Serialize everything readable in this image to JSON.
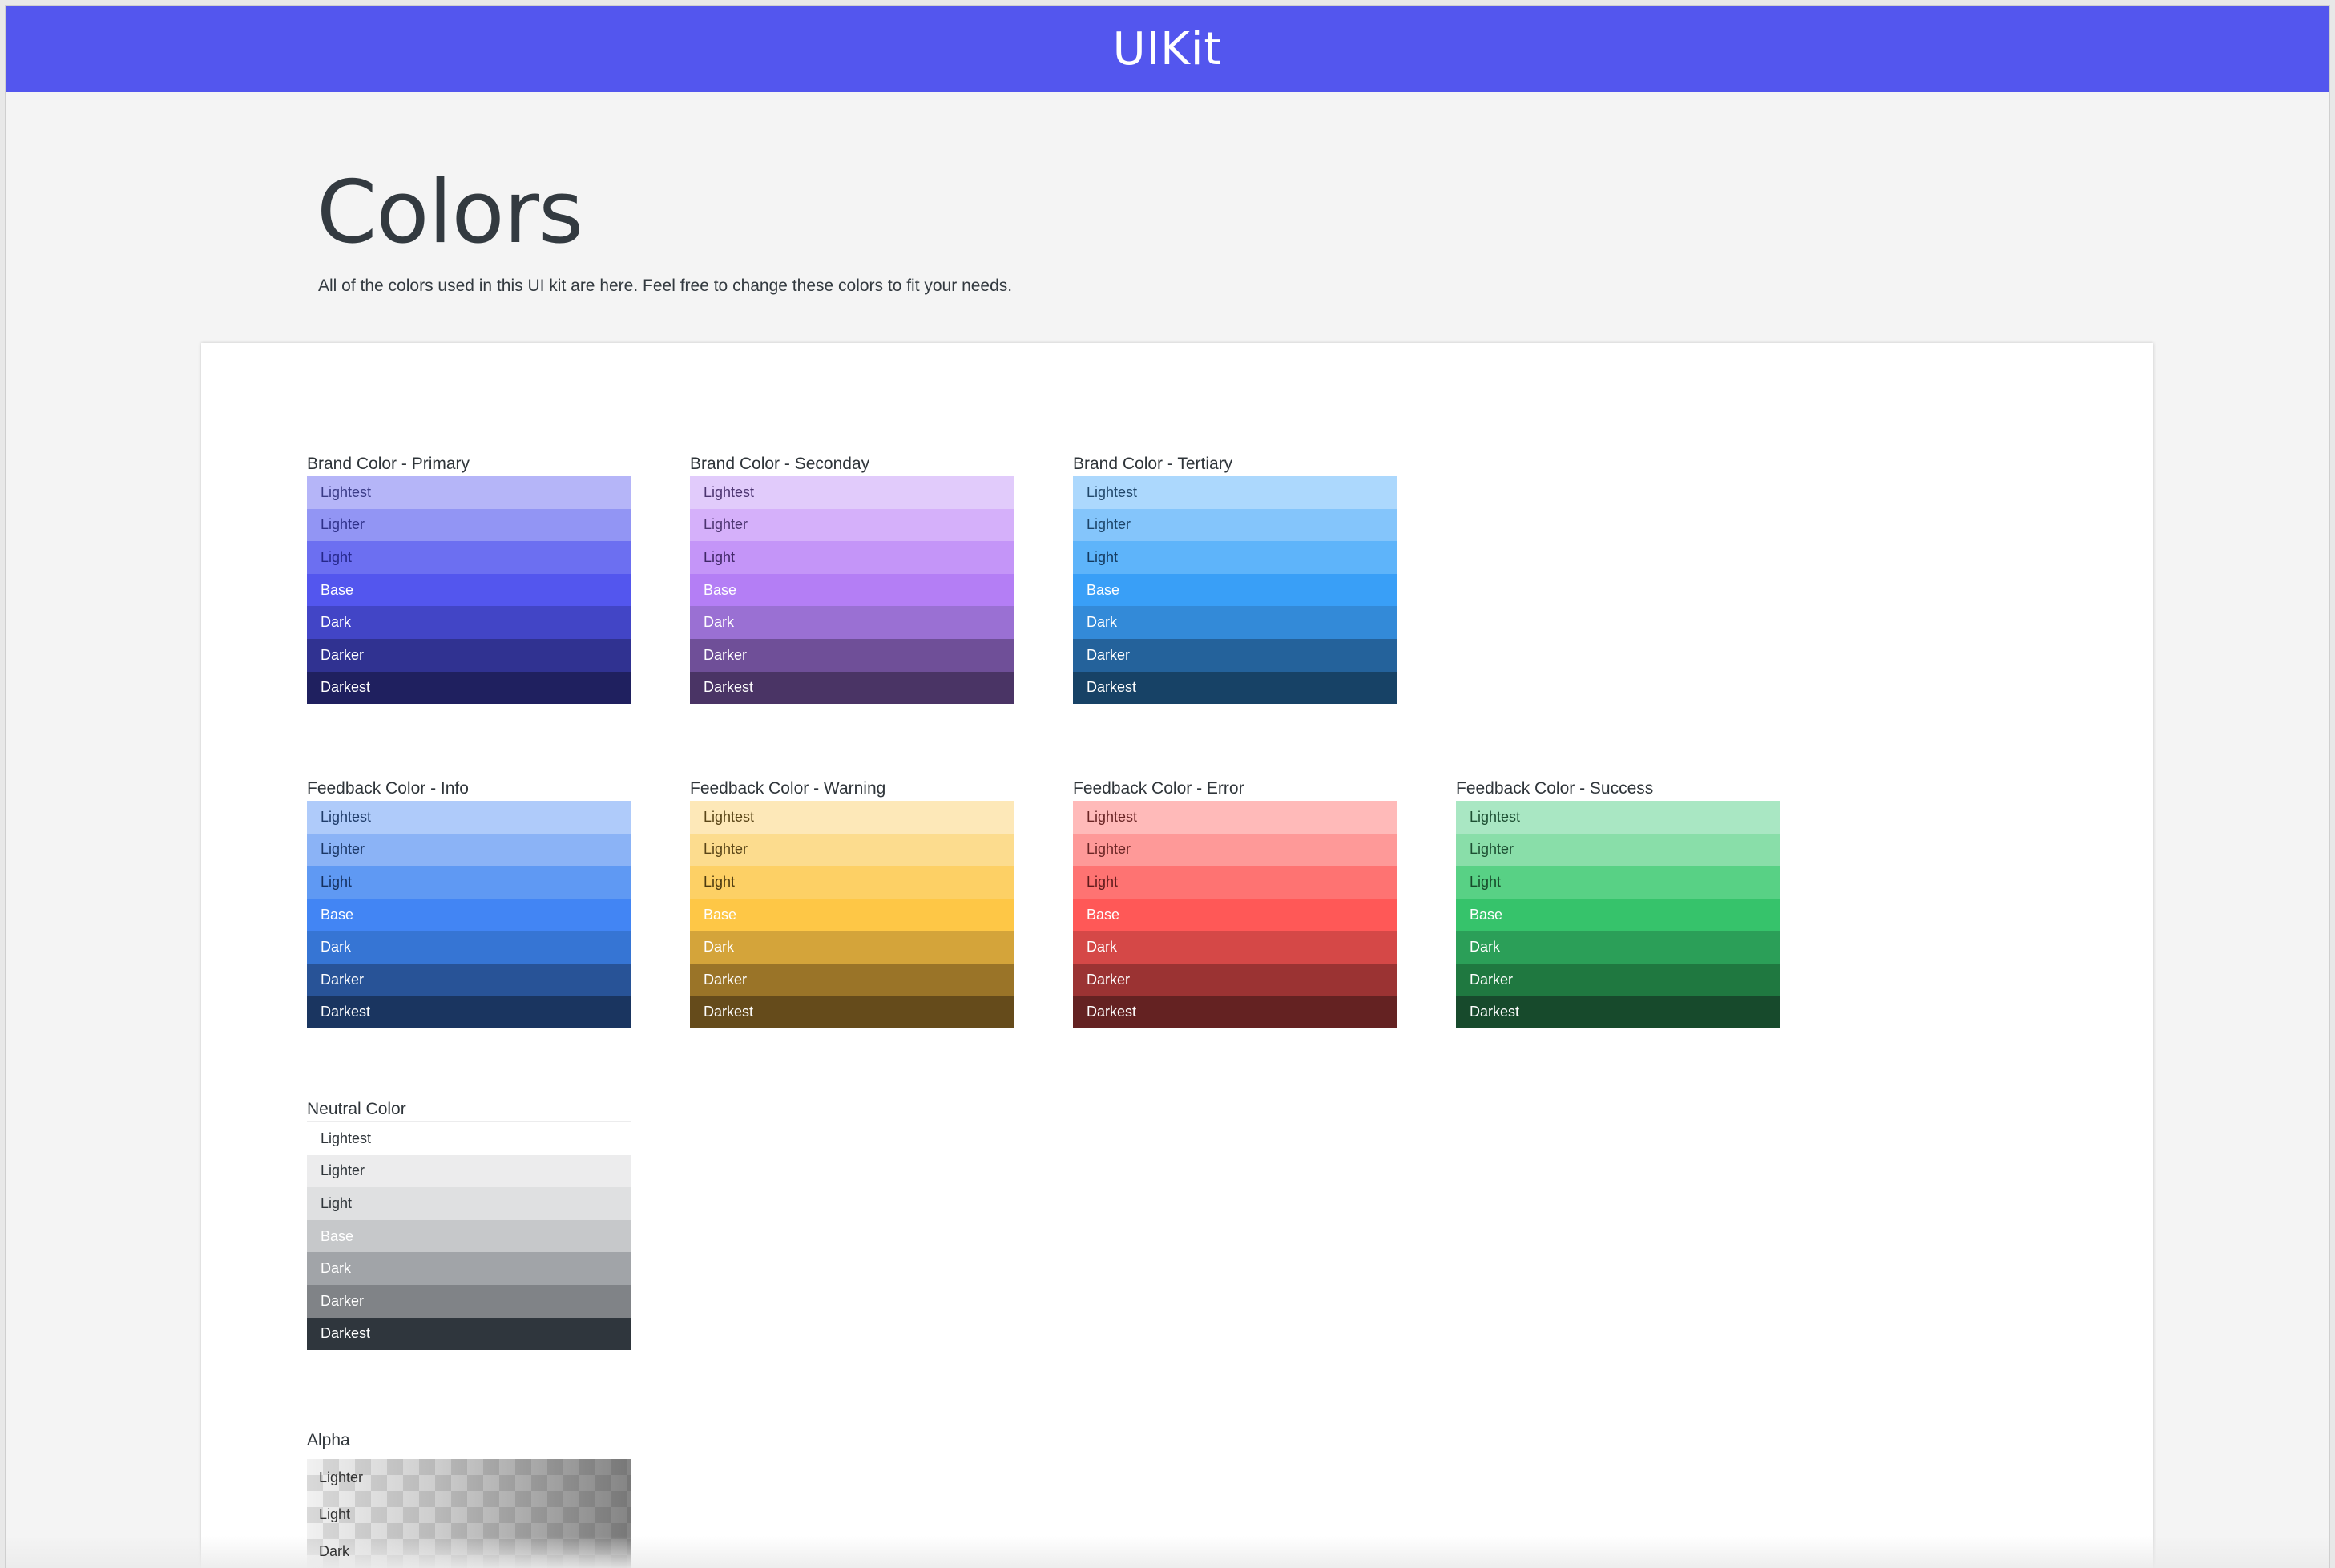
{
  "header": {
    "brand": "UIKit",
    "color": "#5356ee"
  },
  "page": {
    "title": "Colors",
    "description": "All of the colors used in this UI kit are here. Feel free to change these colors to fit your needs."
  },
  "groups": [
    {
      "id": "brand-primary",
      "title": "Brand Color - Primary",
      "swatches": [
        {
          "label": "Lightest",
          "color": "#b5b5f8",
          "text": "#3a3b86"
        },
        {
          "label": "Lighter",
          "color": "#9295f4",
          "text": "#2f318a"
        },
        {
          "label": "Light",
          "color": "#6c6ff1",
          "text": "#25278a"
        },
        {
          "label": "Base",
          "color": "#5356ee",
          "text": "#ffffff"
        },
        {
          "label": "Dark",
          "color": "#4245c6",
          "text": "#ffffff"
        },
        {
          "label": "Darker",
          "color": "#303291",
          "text": "#ffffff"
        },
        {
          "label": "Darkest",
          "color": "#1f205f",
          "text": "#ffffff"
        }
      ]
    },
    {
      "id": "brand-secondary",
      "title": "Brand Color - Seconday",
      "swatches": [
        {
          "label": "Lightest",
          "color": "#e1cbfb",
          "text": "#4c3470"
        },
        {
          "label": "Lighter",
          "color": "#d5b0fa",
          "text": "#4c3470"
        },
        {
          "label": "Light",
          "color": "#c495f8",
          "text": "#3f2766"
        },
        {
          "label": "Base",
          "color": "#b47ef5",
          "text": "#ffffff"
        },
        {
          "label": "Dark",
          "color": "#9a70d3",
          "text": "#ffffff"
        },
        {
          "label": "Darker",
          "color": "#6f4f98",
          "text": "#ffffff"
        },
        {
          "label": "Darkest",
          "color": "#4a3465",
          "text": "#ffffff"
        }
      ]
    },
    {
      "id": "brand-tertiary",
      "title": "Brand Color - Tertiary",
      "swatches": [
        {
          "label": "Lightest",
          "color": "#acd8fd",
          "text": "#21476a"
        },
        {
          "label": "Lighter",
          "color": "#84c5fb",
          "text": "#1c4468"
        },
        {
          "label": "Light",
          "color": "#5eb4fa",
          "text": "#14395d"
        },
        {
          "label": "Base",
          "color": "#399ff7",
          "text": "#ffffff"
        },
        {
          "label": "Dark",
          "color": "#338ad8",
          "text": "#ffffff"
        },
        {
          "label": "Darker",
          "color": "#24629b",
          "text": "#ffffff"
        },
        {
          "label": "Darkest",
          "color": "#174266",
          "text": "#ffffff"
        }
      ]
    },
    {
      "id": "feedback-info",
      "title": "Feedback Color - Info",
      "swatches": [
        {
          "label": "Lightest",
          "color": "#afcbfa",
          "text": "#1f3c6a"
        },
        {
          "label": "Lighter",
          "color": "#8bb3f6",
          "text": "#1b3766"
        },
        {
          "label": "Light",
          "color": "#5f99f3",
          "text": "#15305f"
        },
        {
          "label": "Base",
          "color": "#4285f4",
          "text": "#ffffff"
        },
        {
          "label": "Dark",
          "color": "#3675d4",
          "text": "#ffffff"
        },
        {
          "label": "Darker",
          "color": "#285397",
          "text": "#ffffff"
        },
        {
          "label": "Darkest",
          "color": "#1a3560",
          "text": "#ffffff"
        }
      ]
    },
    {
      "id": "feedback-warning",
      "title": "Feedback Color - Warning",
      "swatches": [
        {
          "label": "Lightest",
          "color": "#fde8b8",
          "text": "#5a4618"
        },
        {
          "label": "Lighter",
          "color": "#fcdc8e",
          "text": "#5a4618"
        },
        {
          "label": "Light",
          "color": "#fdd065",
          "text": "#4e3b10"
        },
        {
          "label": "Base",
          "color": "#fec746",
          "text": "#ffffff"
        },
        {
          "label": "Dark",
          "color": "#d4a43a",
          "text": "#ffffff"
        },
        {
          "label": "Darker",
          "color": "#9a7428",
          "text": "#ffffff"
        },
        {
          "label": "Darkest",
          "color": "#654b1b",
          "text": "#ffffff"
        }
      ]
    },
    {
      "id": "feedback-error",
      "title": "Feedback Color - Error",
      "swatches": [
        {
          "label": "Lightest",
          "color": "#ffbab9",
          "text": "#6a2525"
        },
        {
          "label": "Lighter",
          "color": "#fe9998",
          "text": "#6a2525"
        },
        {
          "label": "Light",
          "color": "#fe7372",
          "text": "#5e1b1b"
        },
        {
          "label": "Base",
          "color": "#ff5857",
          "text": "#ffffff"
        },
        {
          "label": "Dark",
          "color": "#d54847",
          "text": "#ffffff"
        },
        {
          "label": "Darker",
          "color": "#9b3333",
          "text": "#ffffff"
        },
        {
          "label": "Darkest",
          "color": "#642222",
          "text": "#ffffff"
        }
      ]
    },
    {
      "id": "feedback-success",
      "title": "Feedback Color - Success",
      "swatches": [
        {
          "label": "Lightest",
          "color": "#a9e7c3",
          "text": "#1d4f33"
        },
        {
          "label": "Lighter",
          "color": "#89dea9",
          "text": "#1d4f33"
        },
        {
          "label": "Light",
          "color": "#58d185",
          "text": "#174a2b"
        },
        {
          "label": "Base",
          "color": "#36c36b",
          "text": "#ffffff"
        },
        {
          "label": "Dark",
          "color": "#2b9f58",
          "text": "#ffffff"
        },
        {
          "label": "Darker",
          "color": "#1f7840",
          "text": "#ffffff"
        },
        {
          "label": "Darkest",
          "color": "#174a2c",
          "text": "#ffffff"
        }
      ]
    },
    {
      "id": "neutral",
      "title": "Neutral Color",
      "swatches": [
        {
          "label": "Lightest",
          "color": "#ffffff",
          "text": "#2f353a"
        },
        {
          "label": "Lighter",
          "color": "#ececed",
          "text": "#2f353a"
        },
        {
          "label": "Light",
          "color": "#dfe0e1",
          "text": "#2f353a"
        },
        {
          "label": "Base",
          "color": "#c6c8ca",
          "text": "#ffffff"
        },
        {
          "label": "Dark",
          "color": "#a1a4a8",
          "text": "#ffffff"
        },
        {
          "label": "Darker",
          "color": "#808387",
          "text": "#ffffff"
        },
        {
          "label": "Darkest",
          "color": "#2f363d",
          "text": "#ffffff"
        }
      ]
    }
  ],
  "alpha": {
    "title": "Alpha",
    "rows": [
      "Lighter",
      "Light",
      "Dark"
    ]
  }
}
